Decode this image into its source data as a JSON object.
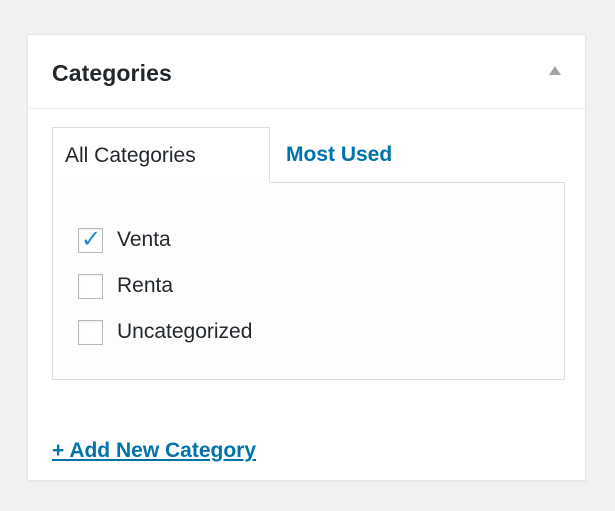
{
  "metabox": {
    "title": "Categories",
    "tabs": [
      {
        "label": "All Categories",
        "active": true
      },
      {
        "label": "Most Used",
        "active": false
      }
    ],
    "categories": [
      {
        "label": "Venta",
        "checked": true
      },
      {
        "label": "Renta",
        "checked": false
      },
      {
        "label": "Uncategorized",
        "checked": false
      }
    ],
    "add_new_label": "+ Add New Category",
    "toggle_icon": "triangle-up-icon",
    "check_symbol": "✓"
  },
  "colors": {
    "link": "#0073aa",
    "checkmark": "#1e8cbe",
    "text": "#23282d",
    "background": "#f1f1f1"
  }
}
